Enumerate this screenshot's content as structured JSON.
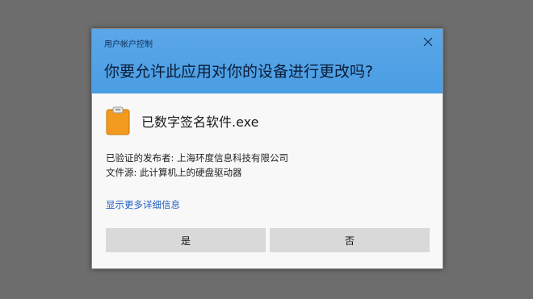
{
  "dialog": {
    "caption": "用户帐户控制",
    "question": "你要允许此应用对你的设备进行更改吗?",
    "app_name": "已数字签名软件.exe",
    "publisher_label": "已验证的发布者:",
    "publisher_value": "上海环度信息科技有限公司",
    "source_label": "文件源:",
    "source_value": "此计算机上的硬盘驱动器",
    "details_link": "显示更多详细信息",
    "yes_label": "是",
    "no_label": "否"
  },
  "colors": {
    "header_bg": "#4a9de3",
    "link": "#1f5fbf",
    "icon_orange": "#f29a1e",
    "button_bg": "#d9d9d9"
  },
  "icons": {
    "close": "close-icon",
    "app": "clipboard-app-icon"
  }
}
